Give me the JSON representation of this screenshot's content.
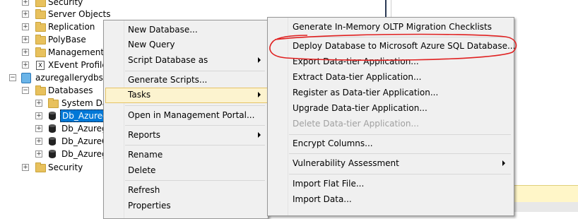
{
  "tree": {
    "items": [
      {
        "label": "Security",
        "icon": "folder-icon"
      },
      {
        "label": "Server Objects",
        "icon": "folder-icon"
      },
      {
        "label": "Replication",
        "icon": "folder-icon"
      },
      {
        "label": "PolyBase",
        "icon": "folder-icon"
      },
      {
        "label": "Management",
        "icon": "folder-icon"
      },
      {
        "label": "XEvent Profiler",
        "icon": "xevent-icon"
      },
      {
        "label": "azuregallerydbserv",
        "icon": "server-icon"
      },
      {
        "label": "Databases",
        "icon": "folder-icon"
      },
      {
        "label": "System Dat",
        "icon": "folder-icon"
      },
      {
        "label": "Db_Azureg",
        "icon": "database-icon",
        "selected": true
      },
      {
        "label": "Db_Azureg",
        "icon": "database-icon"
      },
      {
        "label": "Db_AzureG",
        "icon": "database-icon"
      },
      {
        "label": "Db_Azureg",
        "icon": "database-icon"
      },
      {
        "label": "Security",
        "icon": "folder-icon"
      }
    ]
  },
  "context_menu": {
    "new_database": "New Database...",
    "new_query": "New Query",
    "script_database_as": "Script Database as",
    "generate_scripts": "Generate Scripts...",
    "tasks": "Tasks",
    "open_portal": "Open in Management Portal...",
    "reports": "Reports",
    "rename": "Rename",
    "delete": "Delete",
    "refresh": "Refresh",
    "properties": "Properties"
  },
  "tasks_submenu": {
    "generate_inmemory": "Generate In-Memory OLTP Migration Checklists",
    "deploy_azure": "Deploy Database to Microsoft Azure SQL Database...",
    "export_datatier": "Export Data-tier Application...",
    "extract_datatier": "Extract Data-tier Application...",
    "register_datatier": "Register as Data-tier Application...",
    "upgrade_datatier": "Upgrade Data-tier Application...",
    "delete_datatier": "Delete Data-tier Application...",
    "encrypt_columns": "Encrypt Columns...",
    "vulnerability": "Vulnerability Assessment",
    "import_flat": "Import Flat File...",
    "import_data": "Import Data..."
  },
  "colors": {
    "selection": "#0078d7",
    "menu_highlight": "#fcf3cf",
    "annotation": "#e02020"
  }
}
